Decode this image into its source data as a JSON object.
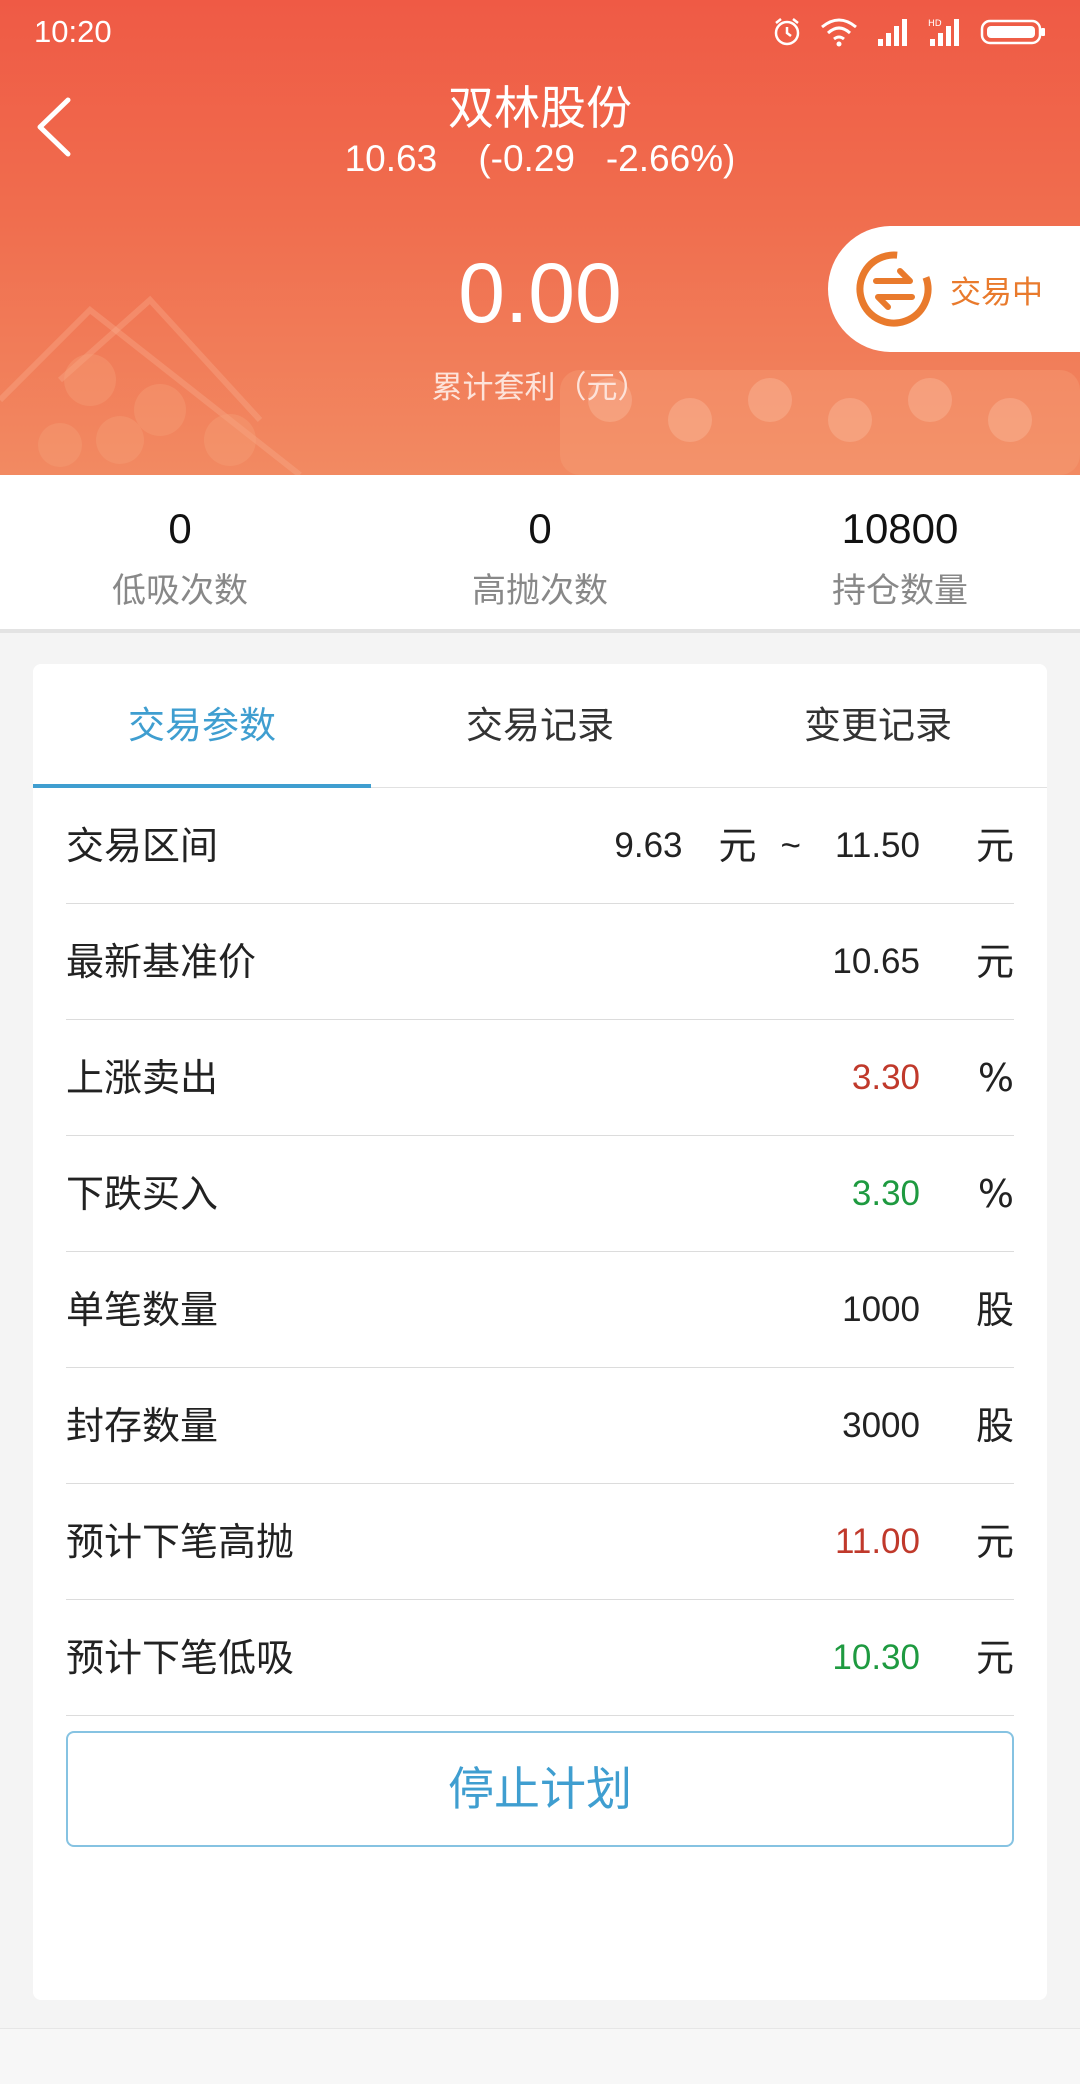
{
  "status_bar": {
    "time": "10:20",
    "icons": [
      "alarm-icon",
      "wifi-icon",
      "signal-icon",
      "signal-hd-icon",
      "battery-icon"
    ]
  },
  "header": {
    "back_icon": "back-chevron-icon",
    "title": "双林股份",
    "quote": "10.63    (-0.29   -2.66%)",
    "profit_value": "0.00",
    "profit_label": "累计套利（元）",
    "status_pill": {
      "label": "交易中",
      "icon": "exchange-icon"
    },
    "colors": {
      "top": "#ef5a45",
      "bottom": "#f28a62"
    }
  },
  "stats": [
    {
      "value": "0",
      "label": "低吸次数"
    },
    {
      "value": "0",
      "label": "高抛次数"
    },
    {
      "value": "10800",
      "label": "持仓数量"
    }
  ],
  "tabs": [
    {
      "label": "交易参数",
      "active": true
    },
    {
      "label": "交易记录",
      "active": false
    },
    {
      "label": "变更记录",
      "active": false
    }
  ],
  "params": {
    "range": {
      "label": "交易区间",
      "low": "9.63",
      "low_unit": "元",
      "sep": "~",
      "high": "11.50",
      "unit": "元"
    },
    "base_price": {
      "label": "最新基准价",
      "value": "10.65",
      "unit": "元"
    },
    "rise_sell": {
      "label": "上涨卖出",
      "value": "3.30",
      "unit": "%"
    },
    "fall_buy": {
      "label": "下跌买入",
      "value": "3.30",
      "unit": "%"
    },
    "lot_size": {
      "label": "单笔数量",
      "value": "1000",
      "unit": "股"
    },
    "locked_qty": {
      "label": "封存数量",
      "value": "3000",
      "unit": "股"
    },
    "next_sell": {
      "label": "预计下笔高抛",
      "value": "11.00",
      "unit": "元"
    },
    "next_buy": {
      "label": "预计下笔低吸",
      "value": "10.30",
      "unit": "元"
    }
  },
  "stop_button": "停止计划",
  "colors": {
    "accent": "#3f9ed0",
    "red": "#c0392b",
    "green": "#1e9a40",
    "pill_text": "#e97a2c"
  }
}
